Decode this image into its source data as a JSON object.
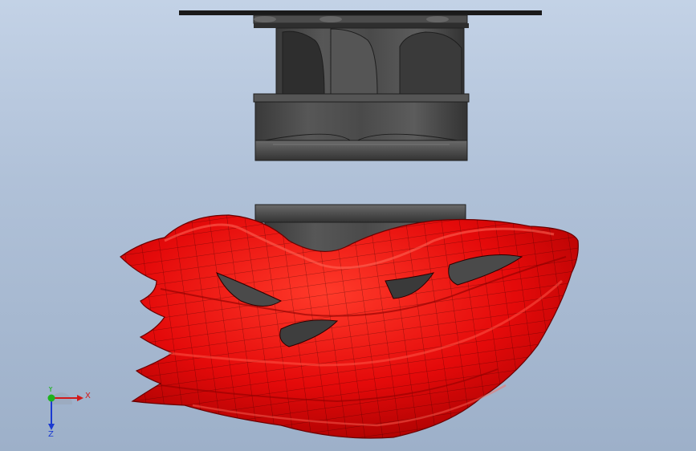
{
  "app": {
    "view": "front",
    "colors": {
      "background_top": "#c3d2e6",
      "background_bottom": "#9db0c9",
      "helmet": "#e80a0a",
      "helmet_highlight": "#ff5a4a",
      "helmet_shadow": "#9a0000",
      "mesh_lines": "#2a0000",
      "mold_body": "#4a4a4a",
      "mold_dark": "#2b2b2b",
      "mold_light": "#7a7a7a",
      "plate": "#1a1a1a"
    }
  },
  "model": {
    "parts": [
      {
        "name": "top-plate"
      },
      {
        "name": "upper-mold"
      },
      {
        "name": "lower-mold"
      },
      {
        "name": "helmet-shell"
      }
    ]
  },
  "triad": {
    "x_label": "X",
    "y_label": "Y",
    "z_label": "Z",
    "x_color": "#d11a1a",
    "y_color": "#1db31d",
    "z_color": "#1a3ad1"
  }
}
